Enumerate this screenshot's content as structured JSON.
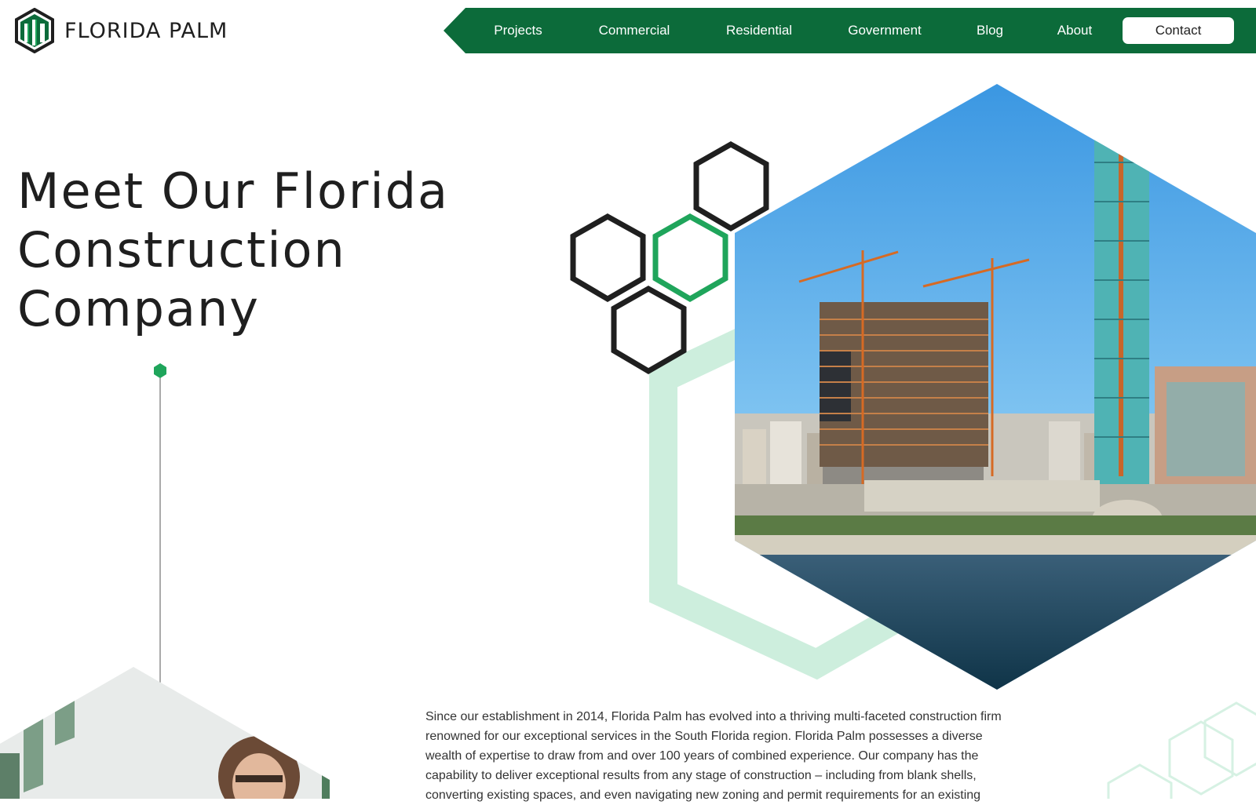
{
  "brand": {
    "name": "FLORIDA PALM",
    "logo_icon": "hexagon-building-logo"
  },
  "colors": {
    "primary_green": "#0c6b3a",
    "accent_green": "#1fa55b",
    "mint": "#cdeedd",
    "dark": "#1f1f1f"
  },
  "nav": {
    "items": [
      {
        "label": "Projects"
      },
      {
        "label": "Commercial"
      },
      {
        "label": "Residential"
      },
      {
        "label": "Government"
      },
      {
        "label": "Blog"
      },
      {
        "label": "About"
      }
    ],
    "contact_label": "Contact"
  },
  "hero": {
    "title_lines": [
      "Meet Our Florida",
      "Construction",
      "Company"
    ]
  },
  "about": {
    "text": "Since our establishment in 2014, Florida Palm has evolved into a thriving multi-faceted construction firm renowned for our exceptional services in the South Florida region. Florida Palm possesses a diverse wealth of expertise to draw from and over 100 years of combined experience. Our company has the capability to deliver exceptional results from any stage of construction – including from blank shells, converting existing spaces, and even navigating new zoning and permit requirements for an existing"
  }
}
